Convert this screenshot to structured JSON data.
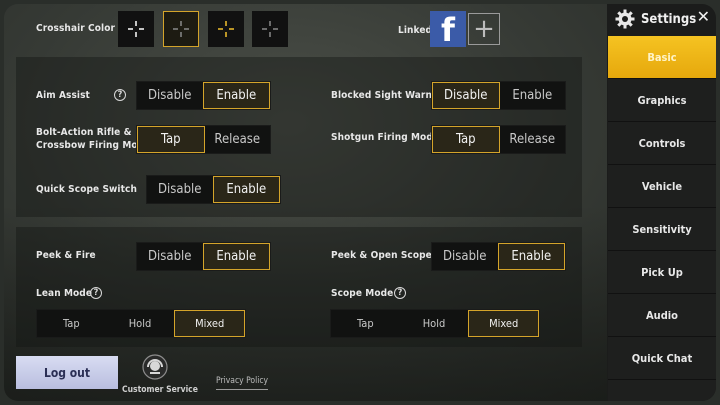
{
  "colors": {
    "accent": "#d4a42a",
    "active_tab": "#f0b416",
    "facebook": "#3b5ba8"
  },
  "top": {
    "crosshair_label": "Crosshair Color",
    "crosshair_options": [
      {
        "color": "#ffffff",
        "selected": false
      },
      {
        "color": "#8a8a8a",
        "selected": true
      },
      {
        "color": "#f2c12e",
        "selected": false
      },
      {
        "color": "#8a8a8a",
        "selected": false
      }
    ],
    "linked_label": "Linked",
    "facebook_glyph": "f",
    "add_glyph": "+"
  },
  "section1": {
    "aim_assist": {
      "label": "Aim Assist",
      "help": "?",
      "options": [
        "Disable",
        "Enable"
      ],
      "selected": 1
    },
    "blocked_sight": {
      "label": "Blocked Sight Warning",
      "options": [
        "Disable",
        "Enable"
      ],
      "selected": 0
    },
    "bolt_action": {
      "label_line1": "Bolt-Action Rifle &",
      "label_line2": "Crossbow Firing Mode",
      "options": [
        "Tap",
        "Release"
      ],
      "selected": 0
    },
    "shotgun": {
      "label": "Shotgun Firing Mode",
      "options": [
        "Tap",
        "Release"
      ],
      "selected": 0
    },
    "quick_scope": {
      "label": "Quick Scope Switch",
      "options": [
        "Disable",
        "Enable"
      ],
      "selected": 1
    }
  },
  "section2": {
    "peek_fire": {
      "label": "Peek & Fire",
      "options": [
        "Disable",
        "Enable"
      ],
      "selected": 1
    },
    "peek_scope": {
      "label": "Peek & Open Scope",
      "options": [
        "Disable",
        "Enable"
      ],
      "selected": 1
    },
    "lean_mode": {
      "label": "Lean Mode",
      "help": "?",
      "options": [
        "Tap",
        "Hold",
        "Mixed"
      ],
      "selected": 2
    },
    "scope_mode": {
      "label": "Scope Mode",
      "help": "?",
      "options": [
        "Tap",
        "Hold",
        "Mixed"
      ],
      "selected": 2
    }
  },
  "bottom": {
    "logout": "Log out",
    "customer_service": "Customer Service",
    "privacy_policy": "Privacy Policy"
  },
  "sidebar": {
    "title": "Settings",
    "close": "✕",
    "items": [
      "Basic",
      "Graphics",
      "Controls",
      "Vehicle",
      "Sensitivity",
      "Pick Up",
      "Audio",
      "Quick Chat"
    ],
    "active": 0
  }
}
